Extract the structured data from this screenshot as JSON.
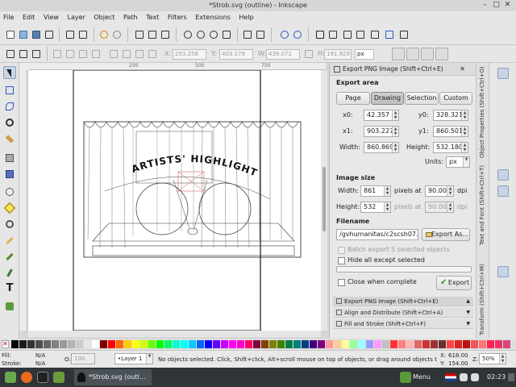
{
  "window": {
    "title": "*Strob.svg (outline) - Inkscape"
  },
  "menu": [
    "File",
    "Edit",
    "View",
    "Layer",
    "Object",
    "Path",
    "Text",
    "Filters",
    "Extensions",
    "Help"
  ],
  "controls": {
    "x": "253.256",
    "y": "403.179",
    "w": "439.071",
    "h": "191.929",
    "unit": "px"
  },
  "ruler": {
    "ticks": [
      "250",
      "500",
      "750"
    ]
  },
  "drawing": {
    "banner": "ARTISTS' HIGHLIGHTS"
  },
  "export": {
    "title": "Export PNG Image (Shift+Ctrl+E)",
    "area_heading": "Export area",
    "area_buttons": [
      "Page",
      "Drawing",
      "Selection",
      "Custom"
    ],
    "active_area": "Drawing",
    "x0_label": "x0:",
    "x0": "42.357",
    "y0_label": "y0:",
    "y0": "328.321",
    "x1_label": "x1:",
    "x1": "903.227",
    "y1_label": "y1:",
    "y1": "860.501",
    "width_label": "Width:",
    "width": "860.869",
    "height_label": "Height:",
    "height": "532.180",
    "units_label": "Units:",
    "units": "px",
    "size_heading": "Image size",
    "img_width_label": "Width:",
    "img_width": "861",
    "img_height_label": "Height:",
    "img_height": "532",
    "pixels_at": "pixels at",
    "dpi_value": "90.00",
    "dpi_value2": "90.00",
    "dpi": "dpi",
    "filename_heading": "Filename",
    "filename": "/gvhumanitas/c2scsh07.jpg",
    "export_as": "Export As...",
    "batch_label": "Batch export 5 selected objects",
    "hide_label": "Hide all except selected",
    "close_label": "Close when complete",
    "export_button": "Export"
  },
  "dialogs": [
    "Export PNG Image (Shift+Ctrl+E)",
    "Align and Distribute (Shift+Ctrl+A)",
    "Fill and Stroke (Shift+Ctrl+F)"
  ],
  "side_tabs": [
    "Object Properties (Shift+Ctrl+O)",
    "Text and Font (Shift+Ctrl+T)",
    "Transform (Shift+Ctrl+M)"
  ],
  "status": {
    "fill_label": "Fill:",
    "fill_value": "N/A",
    "stroke_label": "Stroke:",
    "stroke_value": "N/A",
    "opacity_label": "O:",
    "opacity_value": "100",
    "layer": "•Layer 1",
    "message": "No objects selected. Click, Shift+click, Alt+scroll mouse on top of objects, or drag around objects to s...",
    "x_label": "X:",
    "x_value": "618.00",
    "y_label": "Y:",
    "y_value": "154.00",
    "zoom_label": "Z:",
    "zoom_value": "50%"
  },
  "taskbar": {
    "task_label": "*Strob.svg (outl...",
    "menu_label": "Menu",
    "clock": "02:23"
  },
  "colors": {
    "accent": "#4a8a3a",
    "active_tool": "#c7d4e6",
    "palette": [
      "#000000",
      "#1a1a1a",
      "#333333",
      "#4d4d4d",
      "#666666",
      "#808080",
      "#999999",
      "#b3b3b3",
      "#cccccc",
      "#e6e6e6",
      "#ffffff",
      "#800000",
      "#ff0000",
      "#ff6600",
      "#ffcc00",
      "#ffff00",
      "#ccff00",
      "#66ff00",
      "#00ff00",
      "#00ff66",
      "#00ffcc",
      "#00ffff",
      "#00ccff",
      "#0066ff",
      "#0000ff",
      "#6600ff",
      "#cc00ff",
      "#ff00ff",
      "#ff00cc",
      "#ff0066",
      "#800040",
      "#804000",
      "#808000",
      "#408000",
      "#008040",
      "#008080",
      "#004080",
      "#400080",
      "#800080",
      "#ff9999",
      "#ffcc99",
      "#ffff99",
      "#99ff99",
      "#99ffff",
      "#9999ff",
      "#ff99ff",
      "#c0c0c0",
      "#ff3333",
      "#ff8080",
      "#ffb3b3",
      "#e06666",
      "#cc3333",
      "#993333",
      "#663333",
      "#ff4444",
      "#dd2222",
      "#bb1111",
      "#ee5555",
      "#ff7777",
      "#ff2255",
      "#ee3366",
      "#dd4477"
    ]
  }
}
